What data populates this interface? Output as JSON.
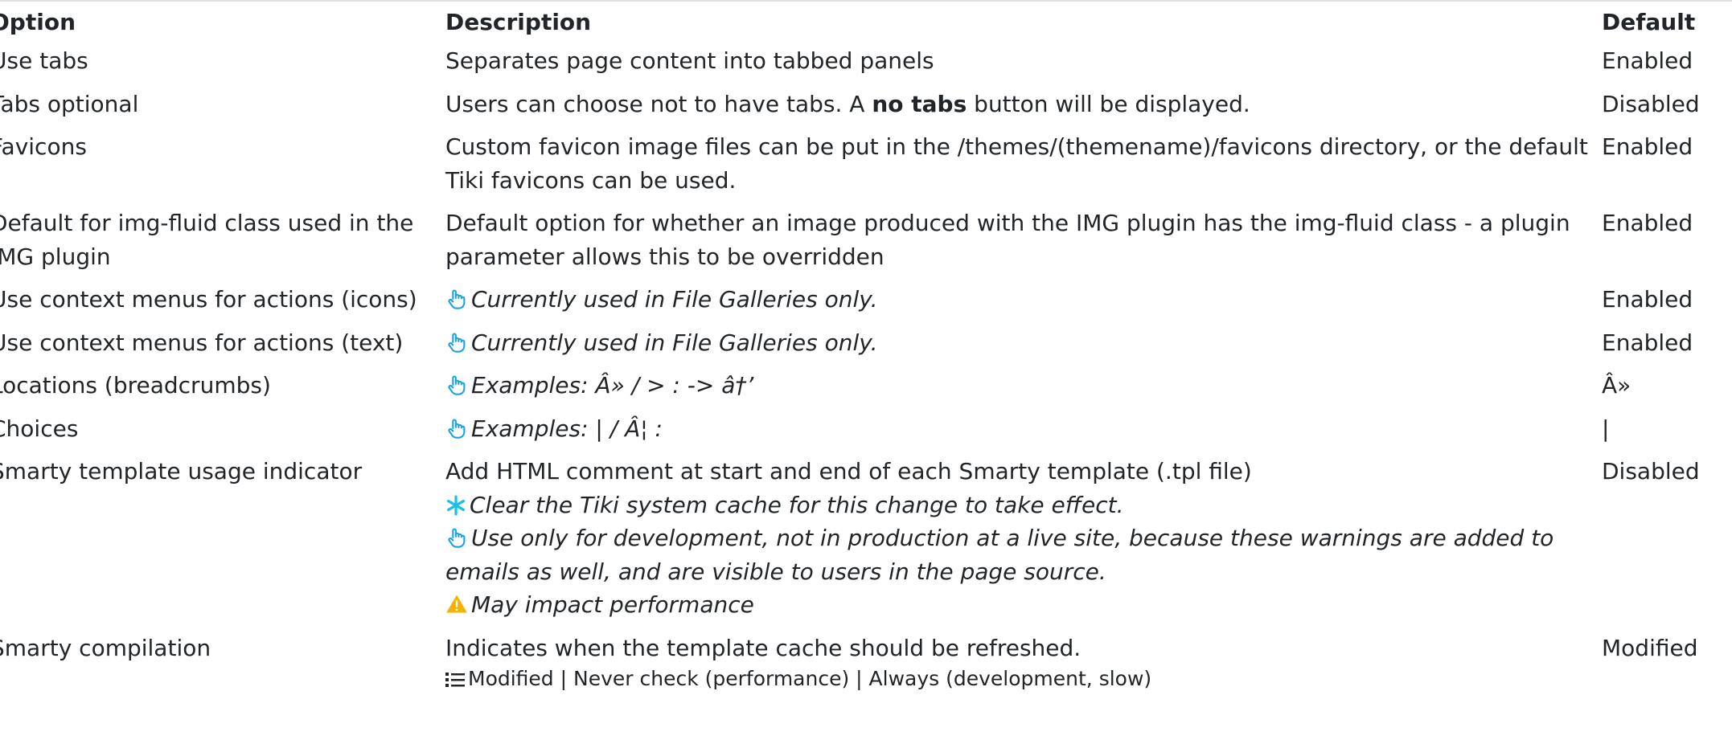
{
  "headers": {
    "option": "Option",
    "description": "Description",
    "default": "Default"
  },
  "rows": [
    {
      "option": "Use tabs",
      "description": "Separates page content into tabbed panels",
      "default": "Enabled"
    },
    {
      "option": "Tabs optional",
      "desc_before": "Users can choose not to have tabs. A ",
      "desc_bold": "no tabs",
      "desc_after": " button will be displayed.",
      "default": "Disabled"
    },
    {
      "option": "Favicons",
      "description": "Custom favicon image files can be put in the /themes/(themename)/favicons directory, or the default Tiki favicons can be used.",
      "default": "Enabled"
    },
    {
      "option": "Default for img-fluid class used in the IMG plugin",
      "description": "Default option for whether an image produced with the IMG plugin has the img-fluid class - a plugin parameter allows this to be overridden",
      "default": "Enabled"
    },
    {
      "option": "Use context menus for actions (icons)",
      "tip": "Currently used in File Galleries only.",
      "default": "Enabled"
    },
    {
      "option": "Use context menus for actions (text)",
      "tip": "Currently used in File Galleries only.",
      "default": "Enabled"
    },
    {
      "option": "Locations (breadcrumbs)",
      "tip": "Examples: Â» / > : -> â†’",
      "default": "Â»"
    },
    {
      "option": "Choices",
      "tip": "Examples: | / Â¦ :",
      "default": "|"
    },
    {
      "option": "Smarty template usage indicator",
      "description": "Add HTML comment at start and end of each Smarty template (.tpl file)",
      "cache_note": "Clear the Tiki system cache for this change to take effect.",
      "tip": "Use only for development, not in production at a live site, because these warnings are added to emails as well, and are visible to users in the page source.",
      "warning": "May impact performance",
      "default": "Disabled"
    },
    {
      "option": "Smarty compilation",
      "description": "Indicates when the template cache should be refreshed.",
      "options_list": "Modified | Never check (performance) | Always (development, slow)",
      "default": "Modified"
    }
  ],
  "colors": {
    "tip_icon": "#1aa3df",
    "cache_icon": "#17c1e8",
    "warning_icon": "#f5b301"
  },
  "icons": {
    "tip": "pointing-hand-icon",
    "cache": "asterisk-icon",
    "warning": "warning-triangle-icon",
    "list": "list-icon"
  }
}
